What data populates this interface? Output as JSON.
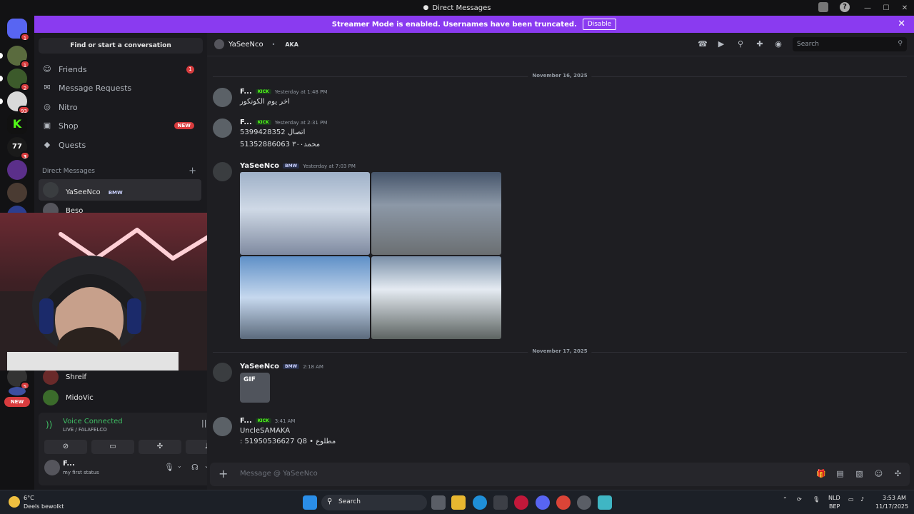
{
  "window": {
    "title": "Direct Messages"
  },
  "banner": {
    "text": "Streamer Mode is enabled. Usernames have been truncated.",
    "button": "Disable"
  },
  "guilds": {
    "badges": [
      "1",
      "1",
      "2",
      "93",
      "3",
      "5"
    ],
    "new_label": "NEW"
  },
  "sidebar": {
    "find": "Find or start a conversation",
    "nav": [
      {
        "label": "Friends",
        "icon": "friends-icon",
        "badge": "1"
      },
      {
        "label": "Message Requests",
        "icon": "mail-icon"
      },
      {
        "label": "Nitro",
        "icon": "nitro-icon"
      },
      {
        "label": "Shop",
        "icon": "shop-icon",
        "badge": "NEW"
      },
      {
        "label": "Quests",
        "icon": "quests-icon"
      }
    ],
    "dm_header": "Direct Messages",
    "dms": [
      {
        "name": "YaSeeNco",
        "tag": "BMW"
      },
      {
        "name": "Beso"
      },
      {
        "name": "Shreif"
      },
      {
        "name": "MidoVic"
      }
    ]
  },
  "voice": {
    "title": "Voice Connected",
    "sub": "LIVE / FALAFELCO"
  },
  "user": {
    "name": "F...",
    "status": "my first status"
  },
  "chat": {
    "header_name": "YaSeeNco",
    "header_aka": "AKA",
    "search_placeholder": "Search",
    "dates": [
      "November 16, 2025",
      "November 17, 2025"
    ],
    "messages": [
      {
        "author": "F...",
        "badge": "KICK",
        "time": "Yesterday at 1:48 PM",
        "lines": [
          "اخر يوم الكونكور"
        ]
      },
      {
        "author": "F...",
        "badge": "KICK",
        "time": "Yesterday at 2:31 PM",
        "lines": [
          "5399428352 اتصال",
          "51352886063 محمد٣٠٠"
        ]
      },
      {
        "author": "YaSeeNco",
        "badge": "BMW",
        "time": "Yesterday at 7:03 PM"
      },
      {
        "author": "YaSeeNco",
        "badge": "BMW",
        "time": "2:18 AM",
        "gif": "GIF"
      },
      {
        "author": "F...",
        "badge": "KICK",
        "time": "3:41 AM",
        "lines": [
          "UncleSAMAKA",
          ": 51950536627 Q8 • مطلوع"
        ]
      }
    ],
    "composer_placeholder": "Message @ YaSeeNco"
  },
  "taskbar": {
    "weather_temp": "6°C",
    "weather_desc": "Deels bewolkt",
    "search": "Search",
    "lang": "NLD",
    "layout": "BEP",
    "time": "3:53 AM",
    "date": "11/17/2025"
  },
  "colors": {
    "accent": "#8a3bf0",
    "green": "#3fbf64",
    "red": "#d83c3e",
    "kick": "#53fc18"
  }
}
